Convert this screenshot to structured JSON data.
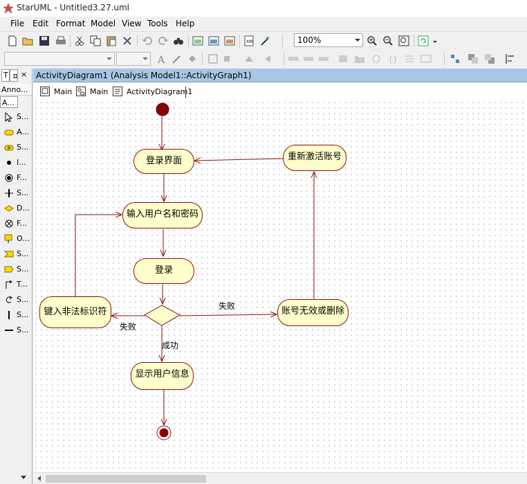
{
  "window": {
    "title": "StarUML - Untitled3.27.uml"
  },
  "menu": {
    "items": [
      "File",
      "Edit",
      "Format",
      "Model",
      "View",
      "Tools",
      "Help"
    ]
  },
  "toolbar": {
    "zoom": "100%"
  },
  "left_panel": {
    "tab_t": "T",
    "tab_pin": "ㅍ",
    "tab_close": "×",
    "header": "Anno...",
    "subheader": "A...",
    "palette": [
      {
        "label": "S...",
        "icon": "select-arrow-icon"
      },
      {
        "label": "A...",
        "icon": "action-state-icon"
      },
      {
        "label": "S...",
        "icon": "subactivity-state-icon"
      },
      {
        "label": "I...",
        "icon": "initial-state-icon"
      },
      {
        "label": "F...",
        "icon": "final-state-icon"
      },
      {
        "label": "S...",
        "icon": "synchronization-icon"
      },
      {
        "label": "D...",
        "icon": "decision-icon"
      },
      {
        "label": "F...",
        "icon": "flow-final-icon"
      },
      {
        "label": "O...",
        "icon": "object-flow-icon"
      },
      {
        "label": "S...",
        "icon": "signal-accept-icon"
      },
      {
        "label": "S...",
        "icon": "signal-send-icon"
      },
      {
        "label": "T...",
        "icon": "transition-icon"
      },
      {
        "label": "S...",
        "icon": "self-transition-icon"
      },
      {
        "label": "S...",
        "icon": "swimlane-vertical-icon"
      },
      {
        "label": "S...",
        "icon": "swimlane-horizontal-icon"
      }
    ]
  },
  "document": {
    "header": "ActivityDiagram1 (Analysis Model1::ActivityGraph1)",
    "tabs": [
      {
        "label": "Main",
        "icon": "class-diagram-icon"
      },
      {
        "label": "Main",
        "icon": "usecase-diagram-icon"
      },
      {
        "label": "ActivityDiagram1",
        "icon": "activity-diagram-icon"
      }
    ]
  },
  "diagram": {
    "nodes": {
      "login_ui": "登录界面",
      "input_credentials": "输入用户名和密码",
      "login": "登录",
      "enter_illegal": "键入非法标识符",
      "account_invalid": "账号无效或删除",
      "reactivate": "重新激活账号",
      "show_info": "显示用户信息"
    },
    "labels": {
      "fail_right": "失败",
      "fail_left": "失败",
      "success": "成功"
    },
    "colors": {
      "node_fill": "#ffffcc",
      "edge": "#8a1010",
      "state_fill": "#8b0000"
    }
  }
}
